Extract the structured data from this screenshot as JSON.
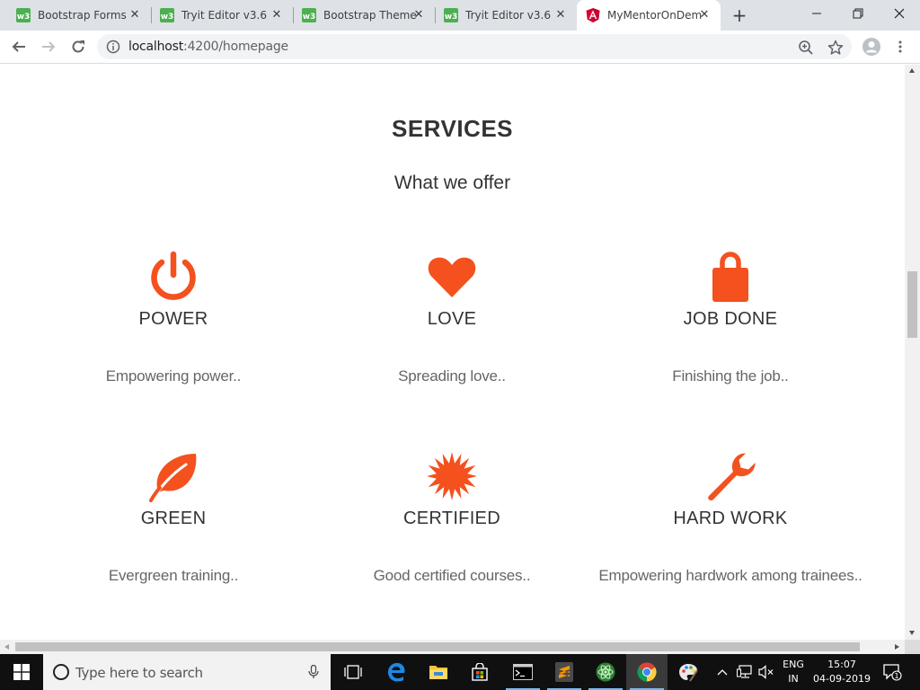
{
  "browser": {
    "tabs": [
      {
        "title": "Bootstrap Forms",
        "favicon": "w3schools-icon",
        "active": false
      },
      {
        "title": "Tryit Editor v3.6",
        "favicon": "w3schools-icon",
        "active": false
      },
      {
        "title": "Bootstrap Theme",
        "favicon": "w3schools-icon",
        "active": false
      },
      {
        "title": "Tryit Editor v3.6",
        "favicon": "w3schools-icon",
        "active": false
      },
      {
        "title": "MyMentorOnDem",
        "favicon": "angular-icon",
        "active": true
      }
    ],
    "close_glyph": "✕",
    "new_tab_glyph": "+",
    "window_controls": {
      "minimize": "—",
      "restore": "❐",
      "close": "✕"
    },
    "url_host": "localhost",
    "url_path": ":4200/homepage"
  },
  "page": {
    "title": "SERVICES",
    "subtitle": "What we offer",
    "accent_color": "#f4511e",
    "services": [
      {
        "icon": "power-icon",
        "name": "POWER",
        "description": "Empowering power.."
      },
      {
        "icon": "heart-icon",
        "name": "LOVE",
        "description": "Spreading love.."
      },
      {
        "icon": "lock-icon",
        "name": "JOB DONE",
        "description": "Finishing the job.."
      },
      {
        "icon": "leaf-icon",
        "name": "GREEN",
        "description": "Evergreen training.."
      },
      {
        "icon": "certificate-icon",
        "name": "CERTIFIED",
        "description": "Good certified courses.."
      },
      {
        "icon": "wrench-icon",
        "name": "HARD WORK",
        "description": "Empowering hardwork among trainees.."
      }
    ]
  },
  "taskbar": {
    "search_placeholder": "Type here to search",
    "language_top": "ENG",
    "language_bottom": "IN",
    "time": "15:07",
    "date": "04-09-2019",
    "notification_count": "1"
  }
}
